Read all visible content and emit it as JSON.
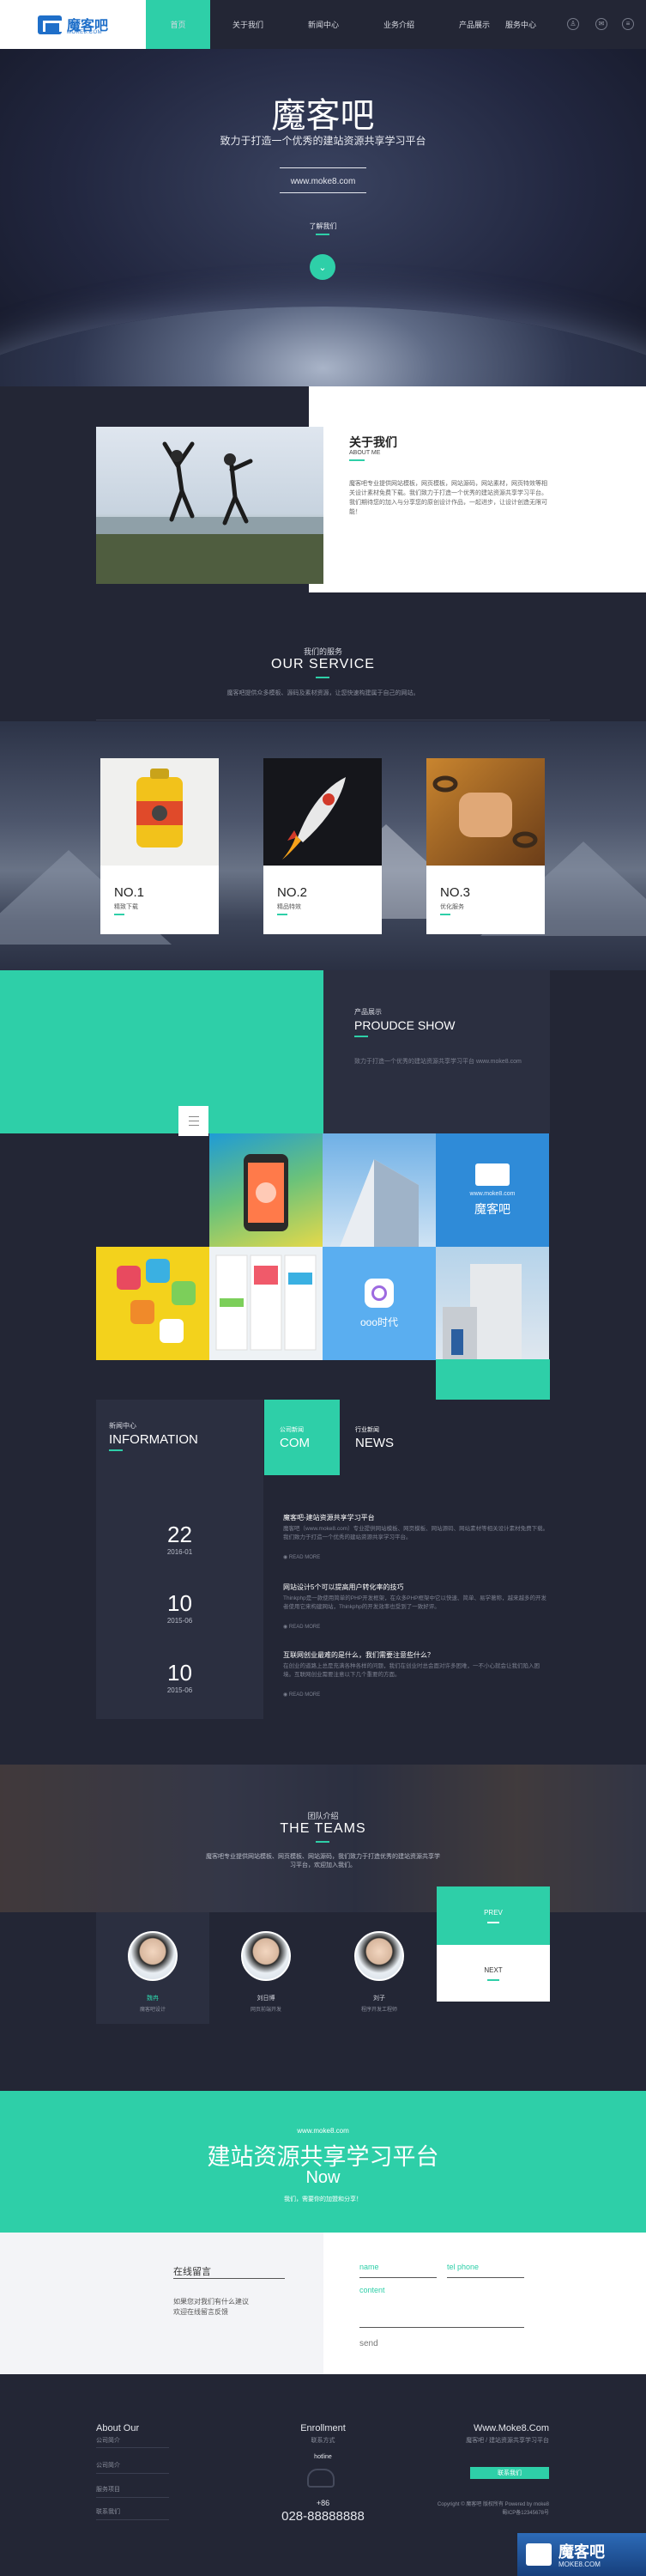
{
  "nav": {
    "logo_text": "魔客吧",
    "logo_sub": "MOKE8.COM",
    "items": [
      "首页",
      "关于我们",
      "新闻中心",
      "业务介绍",
      "产品展示",
      "服务中心"
    ],
    "active_index": 0,
    "icons": [
      "user-icon",
      "chat-icon",
      "menu-icon"
    ]
  },
  "hero": {
    "title": "魔客吧",
    "subtitle": "致力于打造一个优秀的建站资源共享学习平台",
    "url": "www.moke8.com",
    "more_label": "了解我们",
    "arrow_icon": "chevron-down-icon"
  },
  "about": {
    "title": "关于我们",
    "subtitle_en": "ABOUT ME",
    "text": "魔客吧专业提供网站模板，网页模板，网站源码，网站素材，网页特效等相关设计素材免费下载。我们致力于打造一个优秀的建站资源共享学习平台。我们期待您的加入与分享您的原创设计作品，一起进步，让设计创造无限可能！"
  },
  "service": {
    "title_cn": "我们的服务",
    "title_en": "OUR SERVICE",
    "desc": "魔客吧提供众多模板、源码及素材资源，让您快速构建属于自己的网站。",
    "cards": [
      {
        "no": "NO.1",
        "label": "精致下载"
      },
      {
        "no": "NO.2",
        "label": "精品特效"
      },
      {
        "no": "NO.3",
        "label": "优化服务"
      }
    ]
  },
  "product": {
    "title_cn": "产品展示",
    "title_en": "PROUDCE SHOW",
    "desc": "致力于打造一个优秀的建站资源共享学习平台\nwww.moke8.com",
    "menu_icon": "hamburger-icon",
    "tile_labels": {
      "moke": "魔客吧",
      "moke_sub": "www.moke8.com",
      "ooo": "ooo时代"
    }
  },
  "info": {
    "title_cn": "新闻中心",
    "title_en": "INFORMATION",
    "tabs": [
      {
        "small": "公司新闻",
        "big": "COM"
      },
      {
        "small": "行业新闻",
        "big": "NEWS"
      }
    ],
    "dates": [
      {
        "day": "22",
        "ym": "2016-01"
      },
      {
        "day": "10",
        "ym": "2015-06"
      },
      {
        "day": "10",
        "ym": "2015-06"
      }
    ],
    "news": [
      {
        "title": "魔客吧-建站资源共享学习平台",
        "text": "魔客吧（www.moke8.com）专业提供网站模板、网页模板、网站源码、网站素材等相关设计素材免费下载。我们致力于打造一个优秀的建站资源共享学习平台。",
        "more": "READ MORE"
      },
      {
        "title": "网站设计5个可以提高用户转化率的技巧",
        "text": "Thinkphp是一款使用简单的PHP开发框架，在众多PHP框架中它以快速、简单、易学著称，越来越多的开发者使用它来构建网站，Thinkphp的开发效率也受到了一致好评。",
        "more": "READ MORE"
      },
      {
        "title": "互联网创业最难的是什么，我们需要注意些什么？",
        "text": "在创业的道路上总是充满各种各样的问题，我们在创业时总会面对许多困难，一不小心就会让我们陷入困境。互联网创业需要注意以下几个重要的方面。",
        "more": "READ MORE"
      }
    ]
  },
  "teams": {
    "title_cn": "团队介绍",
    "title_en": "THE TEAMS",
    "desc": "魔客吧专业提供网站模板、网页模板、网站源码，我们致力于打造优秀的建站资源共享学习平台，欢迎加入我们。",
    "members": [
      {
        "name": "魏冉",
        "role": "魔客吧设计"
      },
      {
        "name": "刘日博",
        "role": "网页前端开发"
      },
      {
        "name": "刘子",
        "role": "程序开发工程师"
      }
    ],
    "prev": "PREV",
    "next": "NEXT"
  },
  "banner": {
    "url": "www.moke8.com",
    "title": "建站资源共享学习平台",
    "now": "Now",
    "note": "我们，需要你的加盟和分享！"
  },
  "message": {
    "title": "在线留言",
    "text": "如果您对我们有什么建议\n欢迎在线留言反馈",
    "fields": {
      "name": "name",
      "phone": "tel phone",
      "content": "content"
    },
    "send": "send"
  },
  "footer": {
    "about_title": "About Our",
    "about_sub": "公司简介",
    "links": [
      "公司简介",
      "服务项目",
      "联系我们"
    ],
    "enroll_title": "Enrollment",
    "enroll_sub": "联系方式",
    "hotline_label": "hotline",
    "phone_icon": "phone-icon",
    "plus": "+86",
    "phone": "028-88888888",
    "site_title": "Www.Moke8.Com",
    "site_sub": "魔客吧 / 建站资源共享学习平台",
    "site_btn": "联系我们",
    "copyright": "Copyright © 魔客吧 版权所有 Powered by moke8\n蜀ICP备12345678号"
  },
  "watermark": {
    "text": "魔客吧",
    "sub": "MOKE8.COM"
  },
  "colors": {
    "accent": "#2ecfa8",
    "dark": "#232635",
    "dark2": "#2b2f40"
  }
}
